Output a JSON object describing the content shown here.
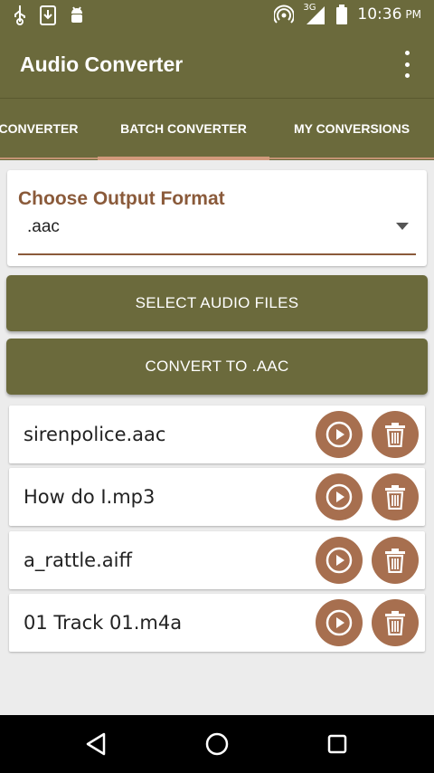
{
  "status_bar": {
    "time": "10:36",
    "meridiem": "PM",
    "network_type": "3G",
    "left_icons": [
      "usb-icon",
      "download-icon",
      "android-debug-icon"
    ],
    "right_icons": [
      "hotspot-icon",
      "signal-icon",
      "battery-icon"
    ]
  },
  "app_bar": {
    "title": "Audio Converter",
    "menu_icon": "more-vert-icon"
  },
  "tabs": [
    {
      "label": "CONVERTER",
      "selected": false
    },
    {
      "label": "BATCH CONVERTER",
      "selected": true
    },
    {
      "label": "MY CONVERSIONS",
      "selected": false
    }
  ],
  "format_picker": {
    "label": "Choose Output Format",
    "selected_value": ".aac"
  },
  "buttons": {
    "select_files": "SELECT AUDIO FILES",
    "convert": "CONVERT TO .AAC"
  },
  "files": [
    {
      "name": "sirenpolice.aac"
    },
    {
      "name": "How do I.mp3"
    },
    {
      "name": "a_rattle.aiff"
    },
    {
      "name": "01 Track 01.m4a"
    }
  ],
  "navigation": {
    "back_icon": "back-icon",
    "home_icon": "home-icon",
    "recents_icon": "recents-icon"
  },
  "colors": {
    "primary": "#6b6a3c",
    "accent": "#a76f4f",
    "label": "#8a5a3a",
    "tab_indicator": "#d29a7c"
  }
}
